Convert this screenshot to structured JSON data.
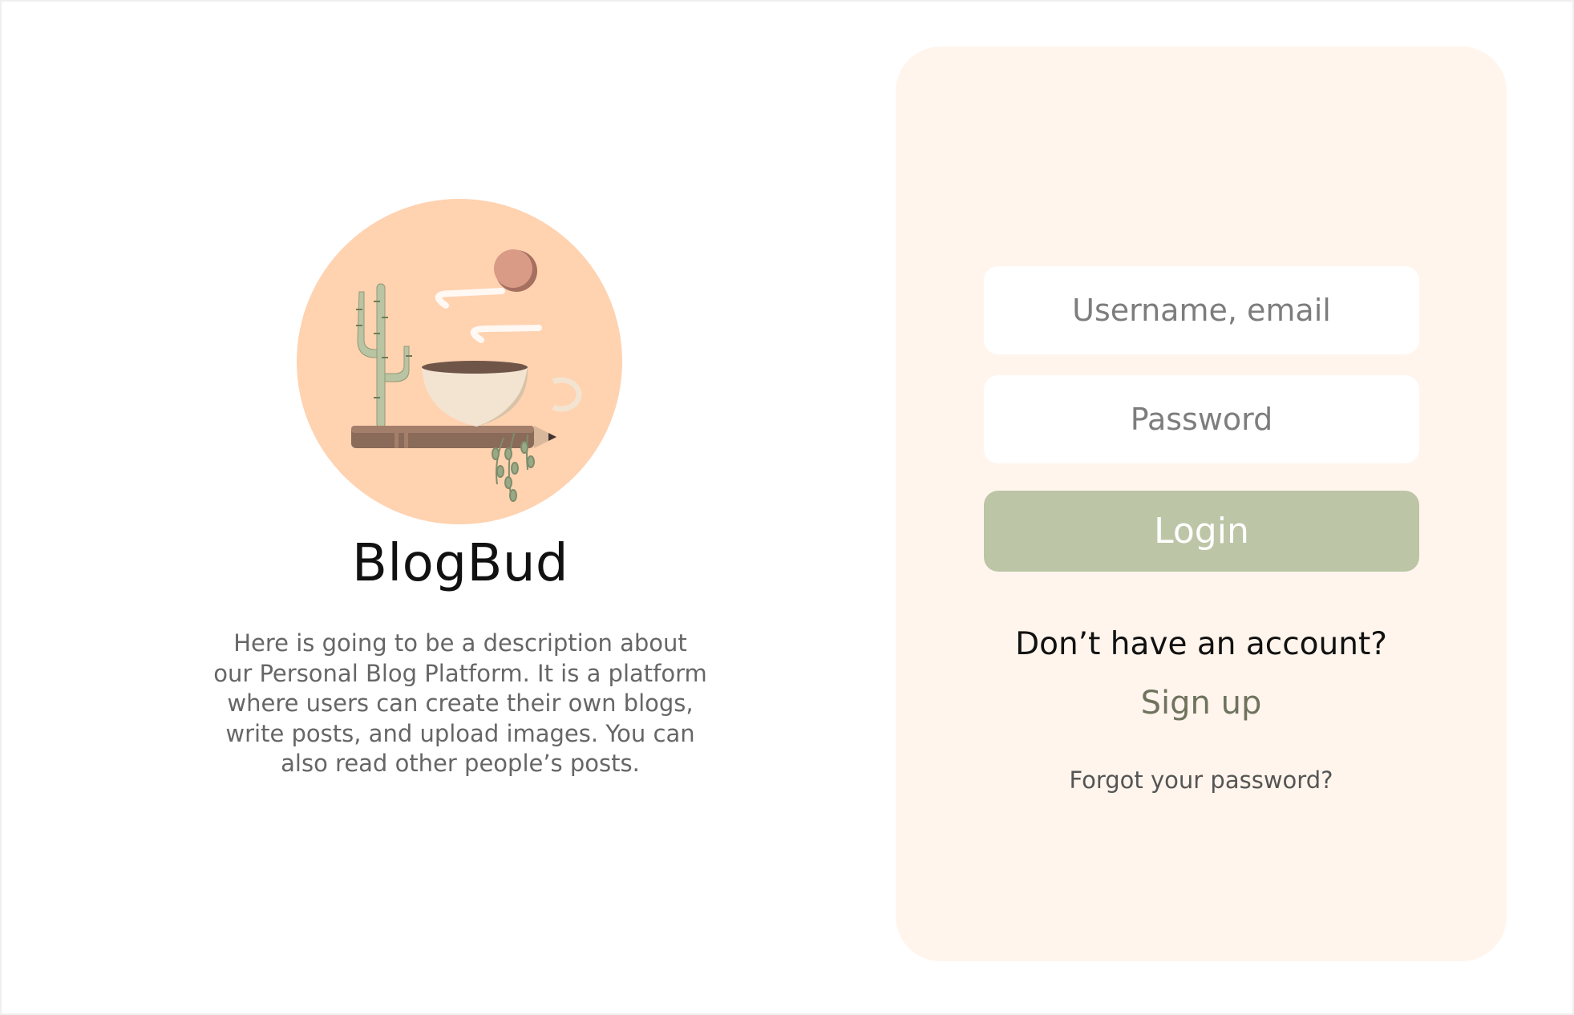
{
  "brand": {
    "name": "BlogBud",
    "description": "Here is going to be a description about our Personal Blog Platform. It is a platform where users can create their own blogs, write posts, and upload images. You can also read other people’s posts.",
    "logo_icon": "coffee-cactus-pencil-illustration"
  },
  "login": {
    "username_placeholder": "Username, email",
    "password_placeholder": "Password",
    "login_label": "Login",
    "no_account_text": "Don’t have an account?",
    "signup_label": "Sign up",
    "forgot_label": "Forgot your password?"
  },
  "colors": {
    "card_background": "#fff5ec",
    "login_button": "#bcc5a6",
    "logo_circle": "#ffd2b0",
    "signup_text": "#6f735e"
  }
}
